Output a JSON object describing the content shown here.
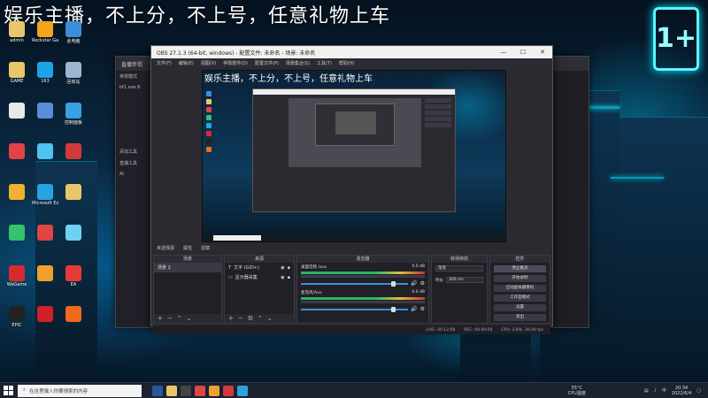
{
  "overlay": {
    "title": "娱乐主播，不上分，不上号，任意礼物上车"
  },
  "desktop": {
    "icons": [
      {
        "label": "admin",
        "color": "#e8c66a"
      },
      {
        "label": "Rockstar Games",
        "color": "#f2a51a"
      },
      {
        "label": "此电脑",
        "color": "#3b8ed8"
      },
      {
        "label": "GAME",
        "color": "#e8c66a"
      },
      {
        "label": "163",
        "color": "#1aa5e8"
      },
      {
        "label": "回收站",
        "color": "#9bb8d0"
      },
      {
        "label": "",
        "color": "#e8e8e8"
      },
      {
        "label": "",
        "color": "#5a8fd8"
      },
      {
        "label": "控制面板",
        "color": "#3aa0e0"
      },
      {
        "label": "",
        "color": "#e04444"
      },
      {
        "label": "",
        "color": "#4ec2f0"
      },
      {
        "label": "",
        "color": "#d03a3a"
      },
      {
        "label": "",
        "color": "#f0b030"
      },
      {
        "label": "Microsoft Edge",
        "color": "#29a3e0"
      },
      {
        "label": "",
        "color": "#e8c66a"
      },
      {
        "label": "",
        "color": "#34c36a"
      },
      {
        "label": "",
        "color": "#e04444"
      },
      {
        "label": "",
        "color": "#6fd0f0"
      },
      {
        "label": "WeGame",
        "color": "#d92b2b"
      },
      {
        "label": "",
        "color": "#f0a030"
      },
      {
        "label": "EA",
        "color": "#e53a3a"
      },
      {
        "label": "EPIC",
        "color": "#222"
      },
      {
        "label": "",
        "color": "#d0202a"
      },
      {
        "label": "",
        "color": "#ef6a1a"
      }
    ]
  },
  "obs_back": {
    "title": "直播伴侣",
    "sidebar": [
      "常规模式",
      "bf1.exe 8",
      "添加工具",
      "直播工具"
    ],
    "ai_label": "AI"
  },
  "obs": {
    "window_title": "OBS 27.1.3 (64-bit, windows) - 配置文件: 未命名 - 场景: 未命名",
    "menu": [
      "文件(F)",
      "编辑(E)",
      "视图(V)",
      "停靠部件(D)",
      "配置文件(P)",
      "场景集合(S)",
      "工具(T)",
      "帮助(H)"
    ],
    "preview_title": "娱乐主播，不上分，不上号，任意礼物上车",
    "dock_header": [
      "未选择源",
      "属性",
      "滤镜"
    ],
    "scenes": {
      "header": "场景",
      "items": [
        "场景 2"
      ]
    },
    "sources": {
      "header": "来源",
      "items": [
        "文字 (GDI+)",
        "显示器采集"
      ]
    },
    "mixer": {
      "header": "混音器",
      "channels": [
        {
          "name": "桌面音频 /aux",
          "db": "0.0 dB"
        },
        {
          "name": "麦克风/Aux",
          "db": "0.0 dB"
        }
      ]
    },
    "transitions": {
      "header": "转场特效",
      "type": "渐变",
      "duration_label": "时长",
      "duration": "300 ms"
    },
    "controls": {
      "header": "控件",
      "buttons": [
        "停止推流",
        "开始录制",
        "启动虚拟摄像机",
        "工作室模式",
        "设置",
        "退出"
      ]
    },
    "status": [
      "LIVE: 00:12:08",
      "REC: 00:00:00",
      "CPU: 3.8%, 30.00 fps"
    ]
  },
  "taskbar": {
    "search_placeholder": "在这里输入你要搜索的内容",
    "weather_temp": "55°C",
    "weather_label": "CPU温度",
    "time": "20:34",
    "date": "2022/6/4",
    "lang": "中"
  },
  "sign": {
    "text": "1+"
  }
}
